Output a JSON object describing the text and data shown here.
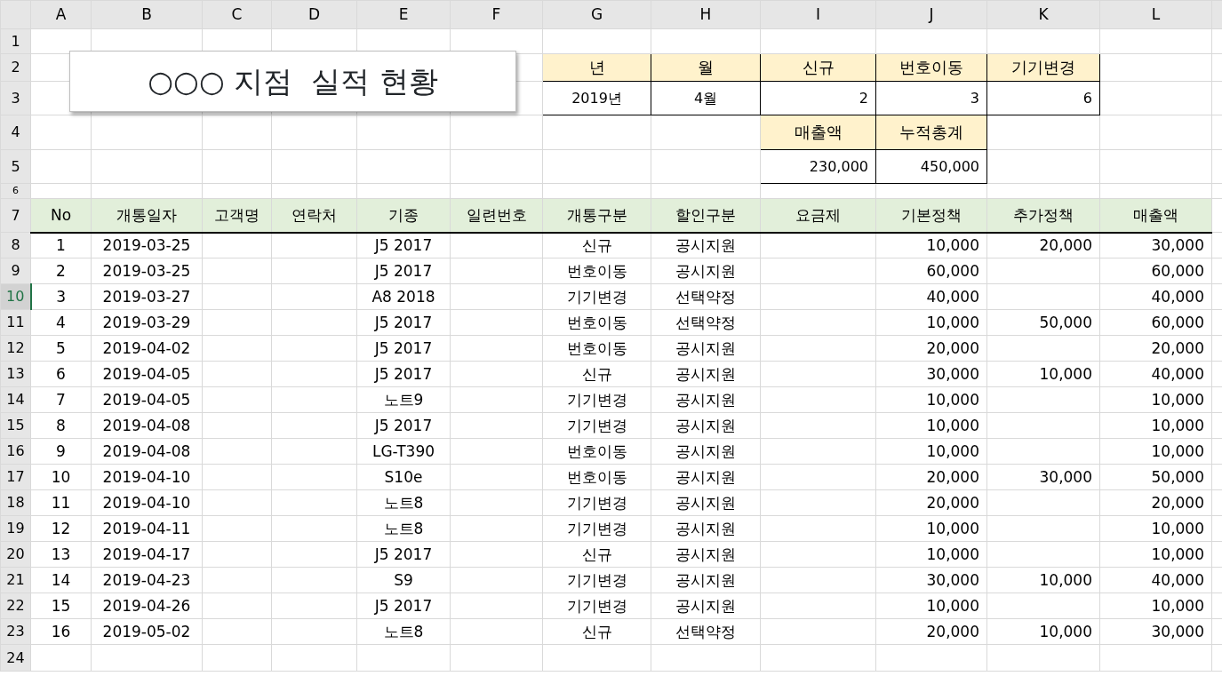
{
  "column_headers": [
    "A",
    "B",
    "C",
    "D",
    "E",
    "F",
    "G",
    "H",
    "I",
    "J",
    "K",
    "L"
  ],
  "row_numbers": [
    {
      "label": "1",
      "selected": false
    },
    {
      "label": "2",
      "selected": false
    },
    {
      "label": "3",
      "selected": false
    },
    {
      "label": "4",
      "selected": false
    },
    {
      "label": "5",
      "selected": false
    },
    {
      "label": "6",
      "selected": false
    },
    {
      "label": "7",
      "selected": false
    },
    {
      "label": "8",
      "selected": false
    },
    {
      "label": "9",
      "selected": false
    },
    {
      "label": "10",
      "selected": true
    },
    {
      "label": "11",
      "selected": false
    },
    {
      "label": "12",
      "selected": false
    },
    {
      "label": "13",
      "selected": false
    },
    {
      "label": "14",
      "selected": false
    },
    {
      "label": "15",
      "selected": false
    },
    {
      "label": "16",
      "selected": false
    },
    {
      "label": "17",
      "selected": false
    },
    {
      "label": "18",
      "selected": false
    },
    {
      "label": "19",
      "selected": false
    },
    {
      "label": "20",
      "selected": false
    },
    {
      "label": "21",
      "selected": false
    },
    {
      "label": "22",
      "selected": false
    },
    {
      "label": "23",
      "selected": false
    },
    {
      "label": "24",
      "selected": false
    }
  ],
  "title_box": "○○○ 지점  실적 현황",
  "summary": {
    "headers": [
      "년",
      "월",
      "신규",
      "번호이동",
      "기기변경"
    ],
    "values": [
      "2019년",
      "4월",
      "2",
      "3",
      "6"
    ],
    "sales_headers": [
      "매출액",
      "누적총계"
    ],
    "sales_values": [
      "230,000",
      "450,000"
    ]
  },
  "table": {
    "columns": [
      "No",
      "개통일자",
      "고객명",
      "연락처",
      "기종",
      "일련번호",
      "개통구분",
      "할인구분",
      "요금제",
      "기본정책",
      "추가정책",
      "매출액"
    ],
    "rows": [
      {
        "no": "1",
        "date": "2019-03-25",
        "model": "J5 2017",
        "activation": "신규",
        "discount": "공시지원",
        "base": "10,000",
        "extra": "20,000",
        "sales": "30,000"
      },
      {
        "no": "2",
        "date": "2019-03-25",
        "model": "J5 2017",
        "activation": "번호이동",
        "discount": "공시지원",
        "base": "60,000",
        "sales": "60,000"
      },
      {
        "no": "3",
        "date": "2019-03-27",
        "model": "A8 2018",
        "activation": "기기변경",
        "discount": "선택약정",
        "base": "40,000",
        "sales": "40,000"
      },
      {
        "no": "4",
        "date": "2019-03-29",
        "model": "J5 2017",
        "activation": "번호이동",
        "discount": "선택약정",
        "base": "10,000",
        "extra": "50,000",
        "sales": "60,000"
      },
      {
        "no": "5",
        "date": "2019-04-02",
        "model": "J5 2017",
        "activation": "번호이동",
        "discount": "공시지원",
        "base": "20,000",
        "sales": "20,000"
      },
      {
        "no": "6",
        "date": "2019-04-05",
        "model": "J5 2017",
        "activation": "신규",
        "discount": "공시지원",
        "base": "30,000",
        "extra": "10,000",
        "sales": "40,000"
      },
      {
        "no": "7",
        "date": "2019-04-05",
        "model": "노트9",
        "activation": "기기변경",
        "discount": "공시지원",
        "base": "10,000",
        "sales": "10,000"
      },
      {
        "no": "8",
        "date": "2019-04-08",
        "model": "J5 2017",
        "activation": "기기변경",
        "discount": "공시지원",
        "base": "10,000",
        "sales": "10,000"
      },
      {
        "no": "9",
        "date": "2019-04-08",
        "model": "LG-T390",
        "activation": "번호이동",
        "discount": "공시지원",
        "base": "10,000",
        "sales": "10,000"
      },
      {
        "no": "10",
        "date": "2019-04-10",
        "model": "S10e",
        "activation": "번호이동",
        "discount": "공시지원",
        "base": "20,000",
        "extra": "30,000",
        "sales": "50,000"
      },
      {
        "no": "11",
        "date": "2019-04-10",
        "model": "노트8",
        "activation": "기기변경",
        "discount": "공시지원",
        "base": "20,000",
        "sales": "20,000"
      },
      {
        "no": "12",
        "date": "2019-04-11",
        "model": "노트8",
        "activation": "기기변경",
        "discount": "공시지원",
        "base": "10,000",
        "sales": "10,000"
      },
      {
        "no": "13",
        "date": "2019-04-17",
        "model": "J5 2017",
        "activation": "신규",
        "discount": "공시지원",
        "base": "10,000",
        "sales": "10,000"
      },
      {
        "no": "14",
        "date": "2019-04-23",
        "model": "S9",
        "activation": "기기변경",
        "discount": "공시지원",
        "base": "30,000",
        "extra": "10,000",
        "sales": "40,000"
      },
      {
        "no": "15",
        "date": "2019-04-26",
        "model": "J5 2017",
        "activation": "기기변경",
        "discount": "공시지원",
        "base": "10,000",
        "sales": "10,000"
      },
      {
        "no": "16",
        "date": "2019-05-02",
        "model": "노트8",
        "activation": "신규",
        "discount": "선택약정",
        "base": "20,000",
        "extra": "10,000",
        "sales": "30,000"
      }
    ]
  }
}
